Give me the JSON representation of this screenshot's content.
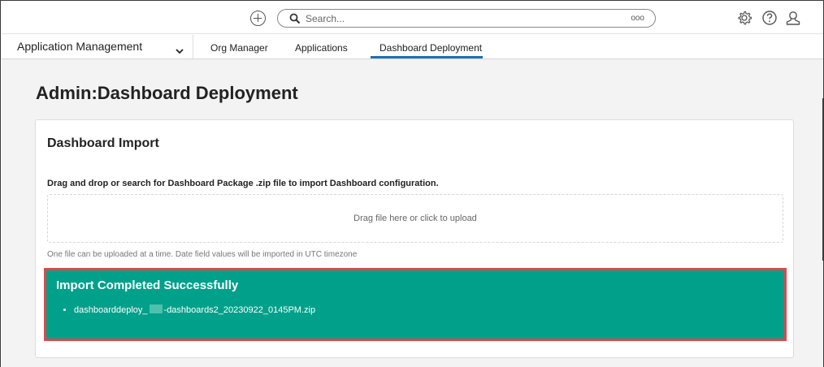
{
  "topbar": {
    "search_placeholder": "Search...",
    "search_more": "ooo",
    "icons": [
      "plus-circle-icon",
      "search-icon",
      "gear-icon",
      "help-icon",
      "user-icon"
    ]
  },
  "nav": {
    "app_title": "Application Management",
    "tabs": [
      {
        "label": "Org Manager"
      },
      {
        "label": "Applications"
      },
      {
        "label": "Dashboard Deployment",
        "active": true
      }
    ]
  },
  "page": {
    "title_prefix": "Admin",
    "title_sep": ":",
    "title_suffix": "Dashboard Deployment"
  },
  "import_card": {
    "title": "Dashboard Import",
    "instruction": "Drag and drop or search for Dashboard Package .zip file to import Dashboard configuration.",
    "dropzone_text": "Drag file here or click to upload",
    "note": "One file can be uploaded at a time. Date field values will be imported in UTC timezone",
    "success": {
      "title": "Import Completed Successfully",
      "file_prefix": "dashboarddeploy_",
      "file_suffix": "-dashboards2_20230922_0145PM.zip"
    }
  },
  "colors": {
    "accent": "#1f6fb2",
    "success_bg": "#00a08a",
    "highlight_border": "#e0474c"
  }
}
